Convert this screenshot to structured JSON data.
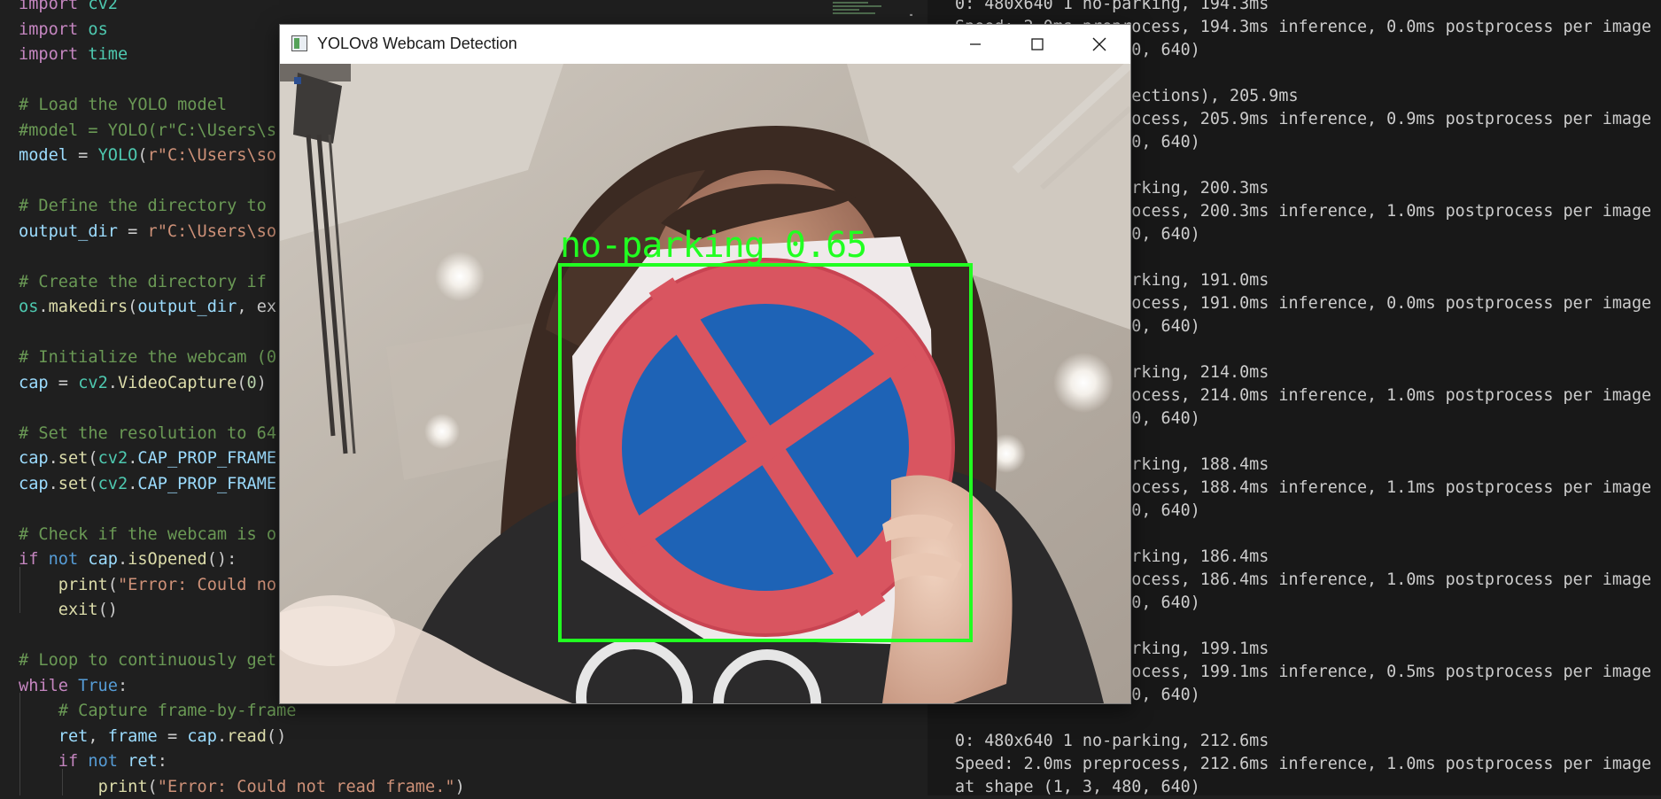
{
  "editor": {
    "lines": [
      [
        [
          "import ",
          "tk-kw"
        ],
        [
          "cv2",
          "tk-cls"
        ]
      ],
      [
        [
          "import ",
          "tk-kw"
        ],
        [
          "os",
          "tk-cls"
        ]
      ],
      [
        [
          "import ",
          "tk-kw"
        ],
        [
          "time",
          "tk-cls"
        ]
      ],
      [],
      [
        [
          "# Load the YOLO model",
          "tk-cm"
        ]
      ],
      [
        [
          "#model = YOLO(r\"C:\\Users\\s",
          "tk-cm"
        ]
      ],
      [
        [
          "model",
          "tk-var"
        ],
        [
          " = ",
          "tk-pl"
        ],
        [
          "YOLO",
          "tk-cls"
        ],
        [
          "(",
          "tk-pl"
        ],
        [
          "r\"C:\\Users\\so",
          "tk-str"
        ]
      ],
      [],
      [
        [
          "# Define the directory to",
          "tk-cm"
        ]
      ],
      [
        [
          "output_dir",
          "tk-var"
        ],
        [
          " = ",
          "tk-pl"
        ],
        [
          "r\"C:\\Users\\so",
          "tk-str"
        ]
      ],
      [],
      [
        [
          "# Create the directory if",
          "tk-cm"
        ]
      ],
      [
        [
          "os",
          "tk-cls"
        ],
        [
          ".",
          "tk-pl"
        ],
        [
          "makedirs",
          "tk-fn"
        ],
        [
          "(",
          "tk-pl"
        ],
        [
          "output_dir",
          "tk-var"
        ],
        [
          ", ex",
          "tk-pl"
        ]
      ],
      [],
      [
        [
          "# Initialize the webcam (0",
          "tk-cm"
        ]
      ],
      [
        [
          "cap",
          "tk-var"
        ],
        [
          " = ",
          "tk-pl"
        ],
        [
          "cv2",
          "tk-cls"
        ],
        [
          ".",
          "tk-pl"
        ],
        [
          "VideoCapture",
          "tk-fn"
        ],
        [
          "(",
          "tk-pl"
        ],
        [
          "0",
          "tk-num"
        ],
        [
          ")",
          "tk-pl"
        ]
      ],
      [],
      [
        [
          "# Set the resolution to 64",
          "tk-cm"
        ]
      ],
      [
        [
          "cap",
          "tk-var"
        ],
        [
          ".",
          "tk-pl"
        ],
        [
          "set",
          "tk-fn"
        ],
        [
          "(",
          "tk-pl"
        ],
        [
          "cv2",
          "tk-cls"
        ],
        [
          ".",
          "tk-pl"
        ],
        [
          "CAP_PROP_FRAME",
          "tk-var"
        ]
      ],
      [
        [
          "cap",
          "tk-var"
        ],
        [
          ".",
          "tk-pl"
        ],
        [
          "set",
          "tk-fn"
        ],
        [
          "(",
          "tk-pl"
        ],
        [
          "cv2",
          "tk-cls"
        ],
        [
          ".",
          "tk-pl"
        ],
        [
          "CAP_PROP_FRAME",
          "tk-var"
        ]
      ],
      [],
      [
        [
          "# Check if the webcam is o",
          "tk-cm"
        ]
      ],
      [
        [
          "if ",
          "tk-kw"
        ],
        [
          "not ",
          "tk-kwb"
        ],
        [
          "cap",
          "tk-var"
        ],
        [
          ".",
          "tk-pl"
        ],
        [
          "isOpened",
          "tk-fn"
        ],
        [
          "():",
          "tk-pl"
        ]
      ],
      [
        [
          "    ",
          "tk-pl"
        ],
        [
          "print",
          "tk-fn"
        ],
        [
          "(",
          "tk-pl"
        ],
        [
          "\"Error: Could no",
          "tk-str"
        ]
      ],
      [
        [
          "    ",
          "tk-pl"
        ],
        [
          "exit",
          "tk-fn"
        ],
        [
          "()",
          "tk-pl"
        ]
      ],
      [],
      [
        [
          "# Loop to continuously get",
          "tk-cm"
        ]
      ],
      [
        [
          "while ",
          "tk-kw"
        ],
        [
          "True",
          "tk-kwb"
        ],
        [
          ":",
          "tk-pl"
        ]
      ],
      [
        [
          "    ",
          "tk-pl"
        ],
        [
          "# Capture frame-by-frame",
          "tk-cm"
        ]
      ],
      [
        [
          "    ",
          "tk-pl"
        ],
        [
          "ret",
          "tk-var"
        ],
        [
          ", ",
          "tk-pl"
        ],
        [
          "frame",
          "tk-var"
        ],
        [
          " = ",
          "tk-pl"
        ],
        [
          "cap",
          "tk-var"
        ],
        [
          ".",
          "tk-pl"
        ],
        [
          "read",
          "tk-fn"
        ],
        [
          "()",
          "tk-pl"
        ]
      ],
      [
        [
          "    ",
          "tk-pl"
        ],
        [
          "if ",
          "tk-kw"
        ],
        [
          "not ",
          "tk-kwb"
        ],
        [
          "ret",
          "tk-var"
        ],
        [
          ":",
          "tk-pl"
        ]
      ],
      [
        [
          "        ",
          "tk-pl"
        ],
        [
          "print",
          "tk-fn"
        ],
        [
          "(",
          "tk-pl"
        ],
        [
          "\"Error: Could not read frame.\"",
          "tk-str"
        ],
        [
          ")",
          "tk-pl"
        ]
      ]
    ]
  },
  "terminal": {
    "lines": [
      "0: 480x640 1 no-parking, 194.3ms",
      "Speed: 2.0ms preprocess, 194.3ms inference, 0.0ms postprocess per image",
      "at shape (1, 3, 480, 640)",
      "",
      "0: 480x640 (no detections), 205.9ms",
      "Speed: 2.0ms preprocess, 205.9ms inference, 0.9ms postprocess per image",
      "at shape (1, 3, 480, 640)",
      "",
      "0: 480x640 1 no-parking, 200.3ms",
      "Speed: 2.0ms preprocess, 200.3ms inference, 1.0ms postprocess per image",
      "at shape (1, 3, 480, 640)",
      "",
      "0: 480x640 1 no-parking, 191.0ms",
      "Speed: 2.0ms preprocess, 191.0ms inference, 0.0ms postprocess per image",
      "at shape (1, 3, 480, 640)",
      "",
      "0: 480x640 1 no-parking, 214.0ms",
      "Speed: 2.0ms preprocess, 214.0ms inference, 1.0ms postprocess per image",
      "at shape (1, 3, 480, 640)",
      "",
      "0: 480x640 1 no-parking, 188.4ms",
      "Speed: 2.0ms preprocess, 188.4ms inference, 1.1ms postprocess per image",
      "at shape (1, 3, 480, 640)",
      "",
      "0: 480x640 1 no-parking, 186.4ms",
      "Speed: 2.0ms preprocess, 186.4ms inference, 1.0ms postprocess per image",
      "at shape (1, 3, 480, 640)",
      "",
      "0: 480x640 1 no-parking, 199.1ms",
      "Speed: 2.0ms preprocess, 199.1ms inference, 0.5ms postprocess per image",
      "at shape (1, 3, 480, 640)",
      "",
      "0: 480x640 1 no-parking, 212.6ms",
      "Speed: 2.0ms preprocess, 212.6ms inference, 1.0ms postprocess per image",
      "at shape (1, 3, 480, 640)"
    ]
  },
  "window": {
    "title": "YOLOv8 Webcam Detection",
    "icons": {
      "app": "opencv-window-icon",
      "minimize": "minimize-icon",
      "maximize": "maximize-icon",
      "close": "close-icon"
    },
    "detection": {
      "label": "no-parking 0.65",
      "box_color": "#21ff21"
    }
  },
  "colors": {
    "editor_bg": "#1f1f1f",
    "terminal_bg": "#181818",
    "comment": "#6a9955",
    "keyword": "#c586c0",
    "string": "#ce9178",
    "variable": "#9cdcfe",
    "function": "#dcdcaa",
    "class": "#4ec9b0"
  }
}
